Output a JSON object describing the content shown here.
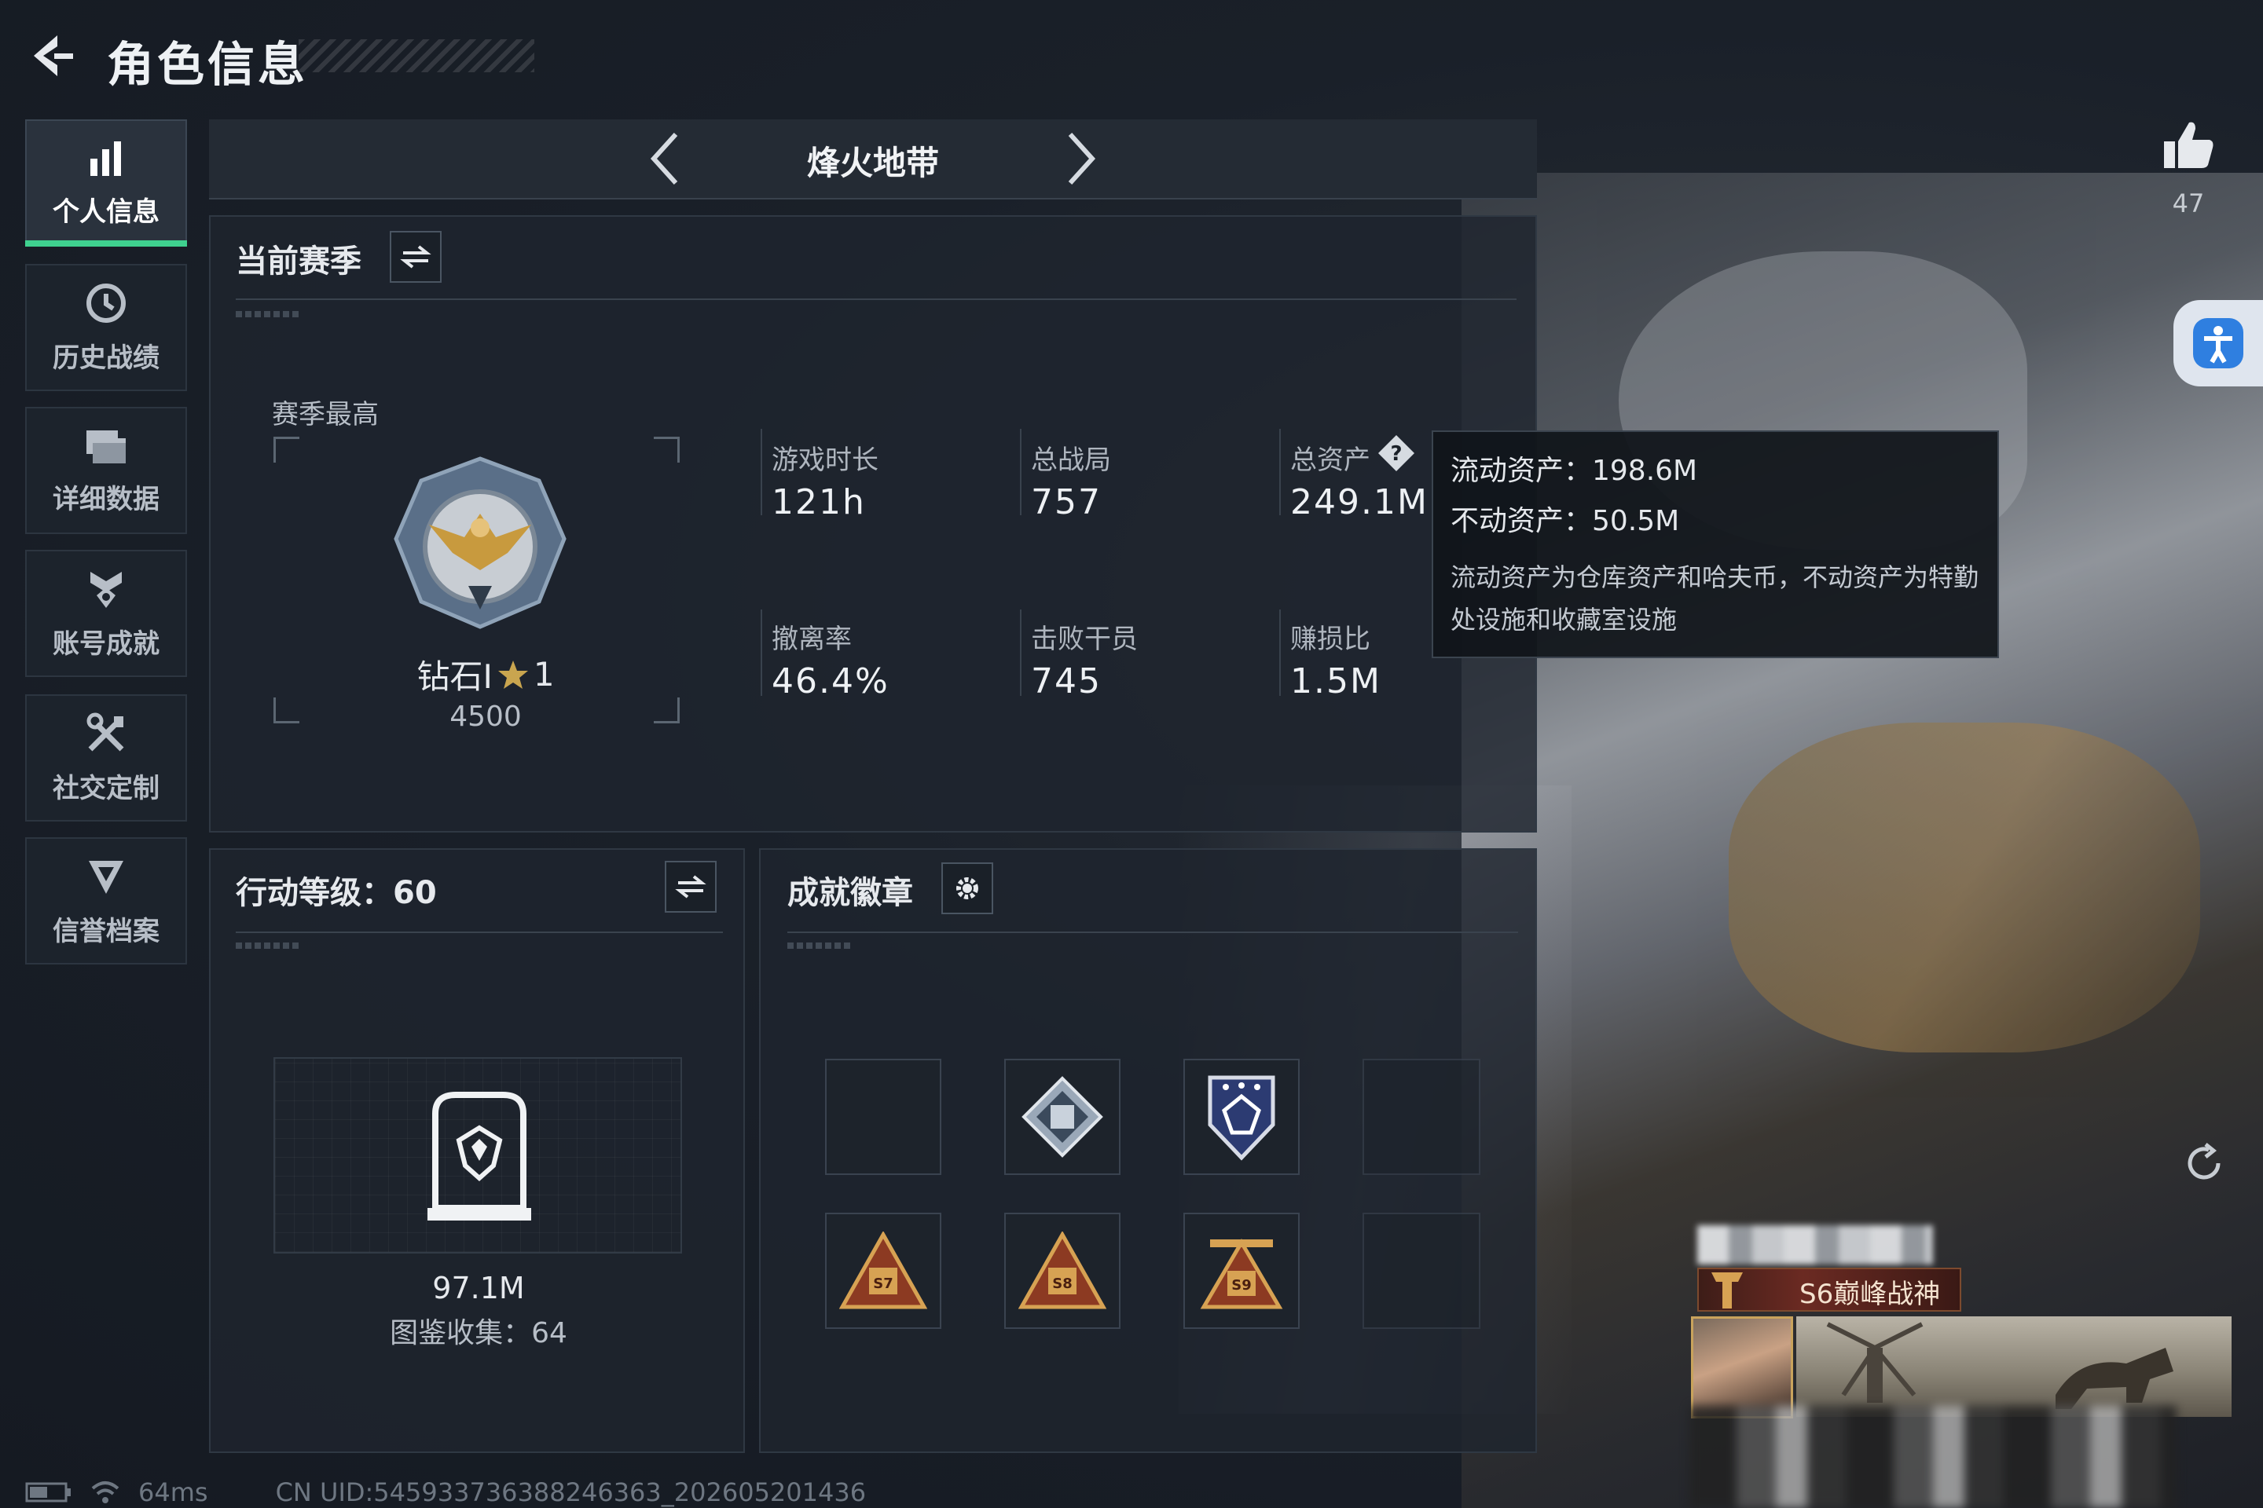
{
  "header": {
    "title": "角色信息"
  },
  "sidebar": {
    "items": [
      {
        "label": "个人信息",
        "icon": "bar-chart-icon",
        "active": true
      },
      {
        "label": "历史战绩",
        "icon": "clock-icon"
      },
      {
        "label": "详细数据",
        "icon": "folders-icon"
      },
      {
        "label": "账号成就",
        "icon": "medal-icon"
      },
      {
        "label": "社交定制",
        "icon": "tools-icon"
      },
      {
        "label": "信誉档案",
        "icon": "shield-icon"
      }
    ]
  },
  "mode": {
    "title": "烽火地带"
  },
  "season": {
    "title": "当前赛季",
    "best_label": "赛季最高",
    "rank_name": "钻石I",
    "rank_stars": "1",
    "rank_score": "4500",
    "stats": [
      {
        "label": "游戏时长",
        "value": "121h"
      },
      {
        "label": "总战局",
        "value": "757"
      },
      {
        "label": "总资产",
        "value": "249.1M"
      },
      {
        "label": "撤离率",
        "value": "46.4%"
      },
      {
        "label": "击败干员",
        "value": "745"
      },
      {
        "label": "赚损比",
        "value": "1.5M"
      }
    ]
  },
  "tooltip": {
    "liquid": "流动资产：198.6M",
    "fixed": "不动资产：50.5M",
    "desc": "流动资产为仓库资产和哈夫币，不动资产为特勤处设施和收藏室设施"
  },
  "action_level": {
    "title": "行动等级：60",
    "value": "97.1M",
    "collection": "图鉴收集：64"
  },
  "achievements": {
    "title": "成就徽章",
    "badges": [
      "",
      "diamond-cube-badge",
      "shield-gem-badge",
      "",
      "s7-triangle-badge",
      "s8-triangle-badge",
      "s9-triangle-badge",
      ""
    ]
  },
  "right": {
    "likes": "47",
    "title_card": "S6巅峰战神"
  },
  "footer": {
    "ping": "64ms",
    "uid": "CN UID:545933736388246363_202605201436"
  },
  "colors": {
    "accent_green": "#3fd18f",
    "bg": "#151b24",
    "panel": "#1e252e"
  }
}
